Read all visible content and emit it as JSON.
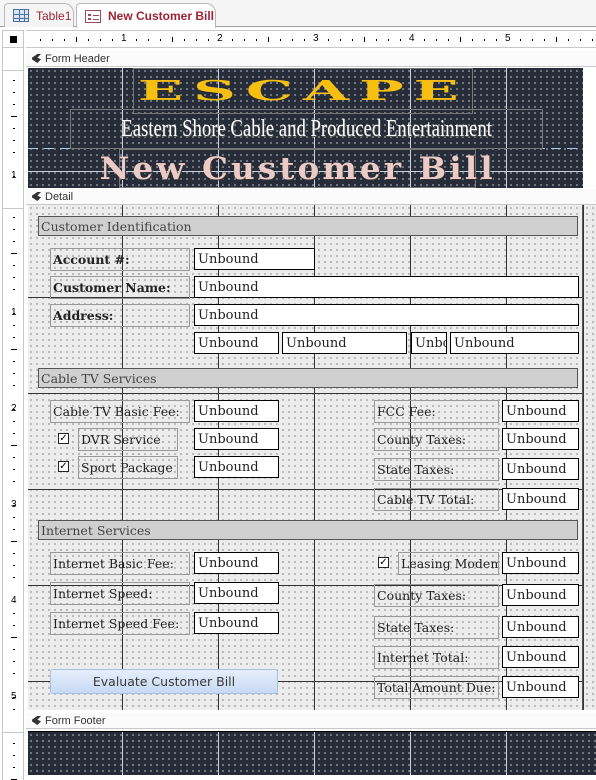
{
  "tabs": [
    {
      "label": "Table1",
      "icon": "table-icon",
      "active": false
    },
    {
      "label": "New Customer Bill",
      "icon": "form-icon",
      "active": true
    }
  ],
  "ruler": {
    "horizontal_numbers": [
      "1",
      "2",
      "3",
      "4",
      "5"
    ],
    "vertical_numbers": [
      "1",
      "1",
      "2",
      "3",
      "4",
      "5"
    ]
  },
  "sections": {
    "header": "Form Header",
    "detail": "Detail",
    "footer": "Form Footer"
  },
  "header": {
    "logo": "ESCAPE",
    "subtitle": "Eastern Shore Cable and Produced Entertainment",
    "title": "New Customer Bill",
    "colors": {
      "logo": "#f7c010",
      "subtitle": "#ffffff",
      "title": "#eccbc6",
      "background": "#262c38"
    }
  },
  "customer": {
    "heading": "Customer Identification",
    "account_label": "Account #:",
    "account_value": "Unbound",
    "name_label": "Customer Name:",
    "name_value": "Unbound",
    "address_label": "Address:",
    "address_value": "Unbound",
    "city_value": "Unbound",
    "state_value": "Unbound",
    "zip_value": "Unbc",
    "phone_value": "Unbound"
  },
  "cable": {
    "heading": "Cable TV Services",
    "basic_fee_label": "Cable TV Basic Fee:",
    "basic_fee_value": "Unbound",
    "dvr_label": "DVR Service",
    "dvr_checked": true,
    "dvr_value": "Unbound",
    "sport_label": "Sport Package",
    "sport_checked": true,
    "sport_value": "Unbound",
    "fcc_label": "FCC Fee:",
    "fcc_value": "Unbound",
    "county_label": "County Taxes:",
    "county_value": "Unbound",
    "state_label": "State Taxes:",
    "state_value": "Unbound",
    "total_label": "Cable TV Total:",
    "total_value": "Unbound"
  },
  "internet": {
    "heading": "Internet Services",
    "basic_fee_label": "Internet Basic Fee:",
    "basic_fee_value": "Unbound",
    "speed_label": "Internet Speed:",
    "speed_value": "Unbound",
    "speed_fee_label": "Internet Speed Fee:",
    "speed_fee_value": "Unbound",
    "modem_label": "Leasing Modem",
    "modem_checked": true,
    "modem_value": "Unbound",
    "county_label": "County Taxes:",
    "county_value": "Unbound",
    "state_label": "State Taxes:",
    "state_value": "Unbound",
    "total_label": "Internet Total:",
    "total_value": "Unbound",
    "amount_due_label": "Total Amount Due:",
    "amount_due_value": "Unbound"
  },
  "evaluate_button": "Evaluate Customer Bill",
  "checkmark": "✓"
}
